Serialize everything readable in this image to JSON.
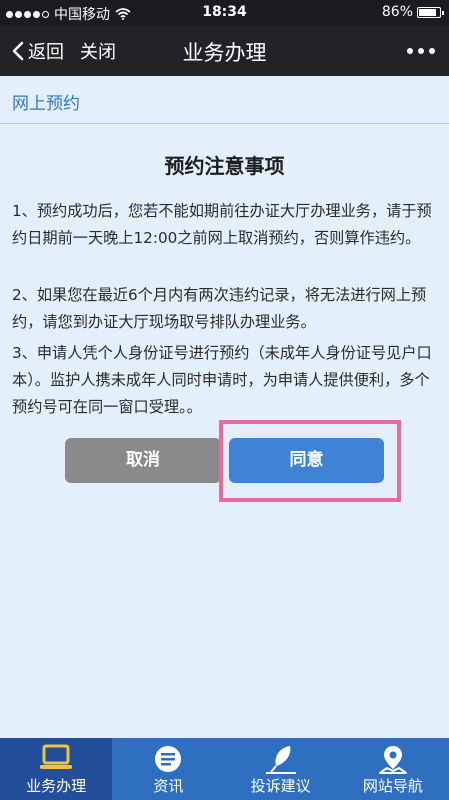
{
  "status_bar": {
    "carrier": "中国移动",
    "time": "18:34",
    "battery": "86%",
    "battery_level": 0.86
  },
  "nav": {
    "back": "返回",
    "close": "关闭",
    "title": "业务办理"
  },
  "section": {
    "title": "网上预约"
  },
  "notice": {
    "title": "预约注意事项",
    "items": [
      "1、预约成功后，您若不能如期前往办证大厅办理业务，请于预约日期前一天晚上12:00之前网上取消预约，否则算作违约。",
      "2、如果您在最近6个月内有两次违约记录，将无法进行网上预约，请您到办证大厅现场取号排队办理业务。",
      "3、申请人凭个人身份证号进行预约（未成年人身份证号见户口本）。监护人携未成年人同时申请时，为申请人提供便利，多个预约号可在同一窗口受理。。"
    ]
  },
  "buttons": {
    "cancel": "取消",
    "agree": "同意"
  },
  "tabs": [
    {
      "label": "业务办理",
      "icon": "laptop-icon"
    },
    {
      "label": "资讯",
      "icon": "news-icon"
    },
    {
      "label": "投诉建议",
      "icon": "feather-icon"
    },
    {
      "label": "网站导航",
      "icon": "map-pin-icon"
    }
  ]
}
